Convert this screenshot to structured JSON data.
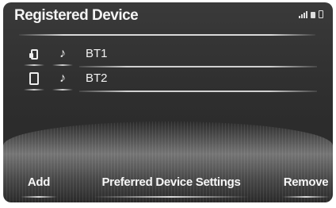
{
  "header": {
    "title": "Registered Device"
  },
  "devices": [
    {
      "name": "BT1",
      "phone_icon": "phone-connected-icon",
      "audio_icon": "music-note-icon"
    },
    {
      "name": "BT2",
      "phone_icon": "phone-icon",
      "audio_icon": "music-note-icon"
    }
  ],
  "buttons": {
    "add": "Add",
    "preferred": "Preferred Device Settings",
    "remove": "Remove"
  },
  "icons": {
    "note_glyph": "♪"
  }
}
